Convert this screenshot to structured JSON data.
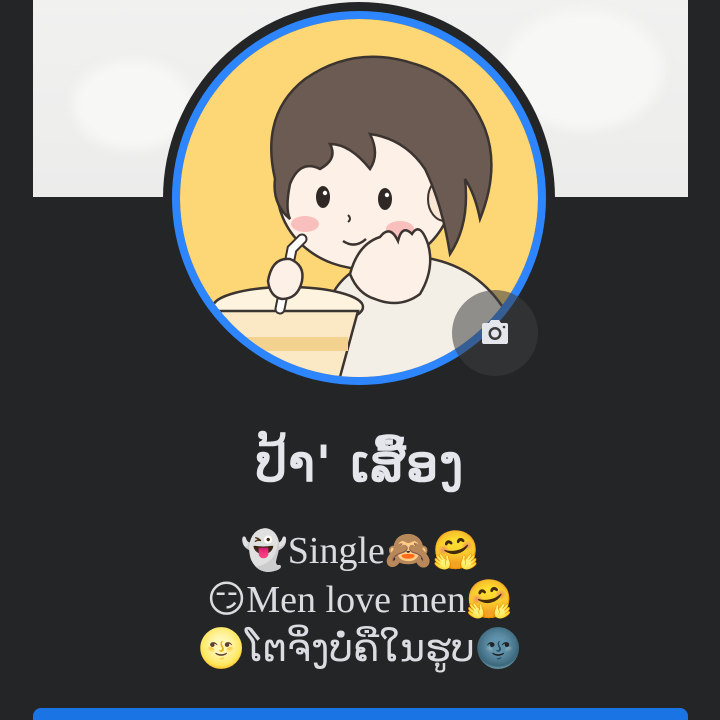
{
  "profile": {
    "name": "ປ້າ' ເສື້ອງ",
    "bio": {
      "line1": {
        "lead_emoji": "👻",
        "text": "Single",
        "trail_emoji": "🙈🤗"
      },
      "line2": {
        "lead_emoji": "😏",
        "text": "Men love men",
        "trail_emoji": "🤗"
      },
      "line3": {
        "lead_emoji": "🌝",
        "text": "ໂຕຈິ່ງບໍ່ຄືໃນຮູບ",
        "trail_emoji": "🌚"
      }
    }
  },
  "icons": {
    "camera": "camera-icon"
  },
  "colors": {
    "background": "#242526",
    "avatar_ring": "#2d86ff",
    "primary_button": "#1b74e4",
    "text": "#e4e6eb"
  }
}
